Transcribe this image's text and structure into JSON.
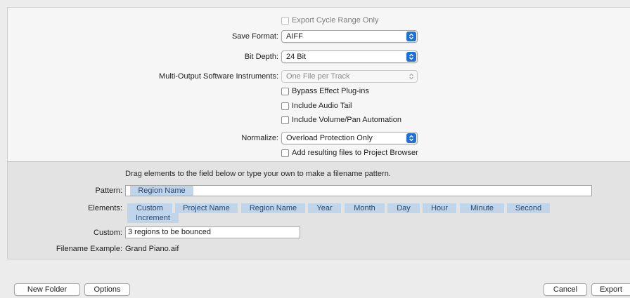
{
  "options": {
    "export_cycle": {
      "label": "Export Cycle Range Only",
      "checked": false,
      "enabled": false
    },
    "save_format": {
      "label": "Save Format:",
      "value": "AIFF"
    },
    "bit_depth": {
      "label": "Bit Depth:",
      "value": "24 Bit"
    },
    "multi_output": {
      "label": "Multi-Output Software Instruments:",
      "value": "One File per Track",
      "enabled": false
    },
    "bypass_effects": {
      "label": "Bypass Effect Plug-ins",
      "checked": false
    },
    "audio_tail": {
      "label": "Include Audio Tail",
      "checked": false
    },
    "volume_pan": {
      "label": "Include Volume/Pan Automation",
      "checked": false
    },
    "normalize": {
      "label": "Normalize:",
      "value": "Overload Protection Only"
    },
    "add_to_browser": {
      "label": "Add resulting files to Project Browser",
      "checked": false
    }
  },
  "filename": {
    "hint": "Drag elements to the field below or type your own to make a filename pattern.",
    "pattern_label": "Pattern:",
    "pattern_tokens": [
      "Region Name"
    ],
    "elements_label": "Elements:",
    "elements": [
      "Custom",
      "Project Name",
      "Region Name",
      "Year",
      "Month",
      "Day",
      "Hour",
      "Minute",
      "Second",
      "Increment"
    ],
    "custom_label": "Custom:",
    "custom_value": "3 regions to be bounced",
    "example_label": "Filename Example:",
    "example_value": "Grand Piano.aif"
  },
  "footer": {
    "new_folder": "New Folder",
    "options": "Options",
    "cancel": "Cancel",
    "export": "Export"
  },
  "colors": {
    "accent": "#1f6fd6",
    "token_bg": "#c0d4ea",
    "token_text": "#274a73"
  }
}
